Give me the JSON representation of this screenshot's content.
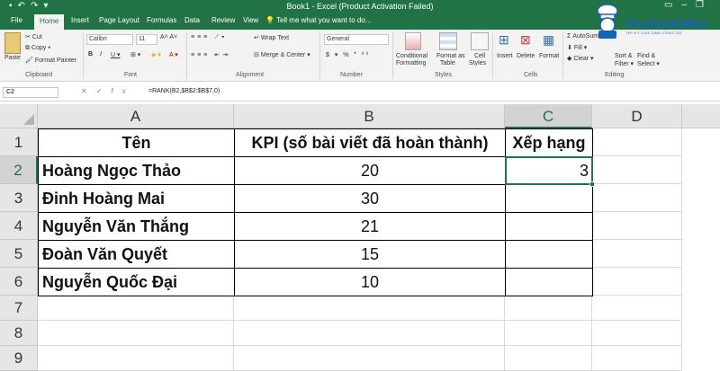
{
  "window": {
    "title": "Book1 - Excel (Product Activation Failed)"
  },
  "tabs": [
    "File",
    "Home",
    "Insert",
    "Page Layout",
    "Formulas",
    "Data",
    "Review",
    "View"
  ],
  "tell_me": "Tell me what you want to do...",
  "logo": {
    "name": "ThuthuatOffice",
    "tagline": "TRI KỶ CỦA DÂN CÔNG SỞ"
  },
  "ribbon": {
    "clipboard": {
      "paste": "Paste",
      "cut": "Cut",
      "copy": "Copy",
      "format_painter": "Format Painter",
      "label": "Clipboard"
    },
    "font": {
      "name": "Calibri",
      "size": "11",
      "label": "Font"
    },
    "alignment": {
      "wrap_text": "Wrap Text",
      "merge_center": "Merge & Center",
      "label": "Alignment"
    },
    "number": {
      "format": "General",
      "label": "Number"
    },
    "styles": {
      "conditional": "Conditional",
      "formatting": "Formatting",
      "format_as": "Format as",
      "table": "Table",
      "cell": "Cell",
      "styles_word": "Styles",
      "label": "Styles"
    },
    "cells": {
      "insert": "Insert",
      "delete": "Delete",
      "format": "Format",
      "label": "Cells"
    },
    "editing": {
      "autosum": "AutoSum",
      "fill": "Fill",
      "clear": "Clear",
      "sort_filter": "Sort &",
      "filter": "Filter",
      "find_select": "Find &",
      "select": "Select",
      "label": "Editing"
    }
  },
  "formula_bar": {
    "name_box": "C2",
    "formula": "=RANK(B2,$B$2:$B$7,0)"
  },
  "columns": [
    "A",
    "B",
    "C",
    "D"
  ],
  "rows": [
    "1",
    "2",
    "3",
    "4",
    "5",
    "6",
    "7",
    "8",
    "9"
  ],
  "sheet": {
    "header": {
      "a": "Tên",
      "b": "KPI (số bài viết đã hoàn thành)",
      "c": "Xếp hạng"
    },
    "rows": [
      {
        "a": "Hoàng Ngọc Thảo",
        "b": "20",
        "c": "3"
      },
      {
        "a": "Đinh Hoàng Mai",
        "b": "30",
        "c": ""
      },
      {
        "a": "Nguyễn Văn Thắng",
        "b": "21",
        "c": ""
      },
      {
        "a": "Đoàn Văn Quyết",
        "b": "15",
        "c": ""
      },
      {
        "a": "Nguyễn Quốc Đại",
        "b": "10",
        "c": ""
      }
    ]
  },
  "colors": {
    "accent": "#217346"
  }
}
